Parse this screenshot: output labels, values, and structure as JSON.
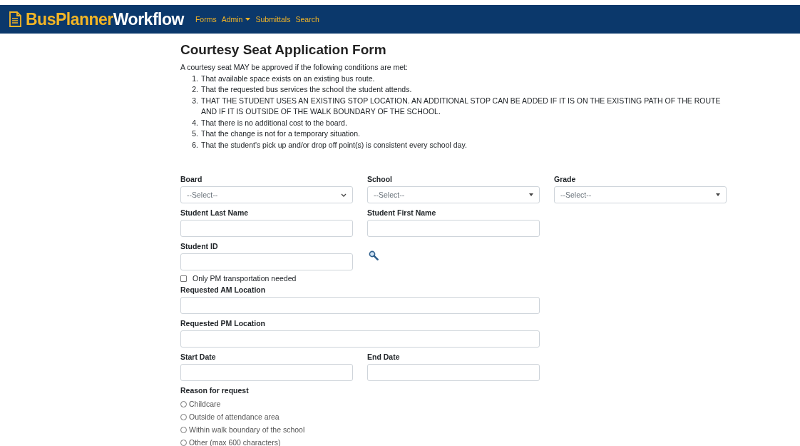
{
  "navbar": {
    "logo": {
      "part_1": "BusPlanner",
      "part_2": "Workflow"
    },
    "links": [
      {
        "label": "Forms",
        "kind": "link"
      },
      {
        "label": "Admin",
        "kind": "dropdown"
      },
      {
        "label": "Submittals",
        "kind": "link"
      },
      {
        "label": "Search",
        "kind": "link"
      }
    ]
  },
  "title": "Courtesy Seat Application Form",
  "intro": "A courtesy seat MAY be approved if the following conditions are met:",
  "conditions": [
    {
      "number": "1.",
      "text": "That available space exists on an existing bus route."
    },
    {
      "number": "2.",
      "text": "That the requested bus services the school the student attends."
    },
    {
      "number": "3.",
      "text": "THAT THE STUDENT USES AN EXISTING STOP LOCATION. AN ADDITIONAL STOP CAN BE ADDED IF IT IS ON THE EXISTING PATH OF THE ROUTE AND IF IT IS OUTSIDE OF THE WALK BOUNDARY OF THE SCHOOL."
    },
    {
      "number": "4.",
      "text": "That there is no additional cost to the board."
    },
    {
      "number": "5.",
      "text": "That the change is not for a temporary situation."
    },
    {
      "number": "6.",
      "text": "That the student's pick up and/or drop off point(s) is consistent every school day."
    }
  ],
  "rows": [
    {
      "fields": [
        {
          "label": "Board",
          "kind": "select",
          "value": "--Select--",
          "caret": {
            "kind": "chevron"
          }
        },
        {
          "label": "School",
          "kind": "select",
          "value": "--Select--",
          "caret": {
            "kind": "triangle"
          }
        },
        {
          "label": "Grade",
          "kind": "select",
          "value": "--Select--",
          "caret": {
            "kind": "triangle"
          }
        }
      ]
    },
    {
      "fields": [
        {
          "label": "Student Last Name",
          "kind": "text"
        },
        {
          "label": "Student First Name",
          "kind": "text"
        }
      ]
    },
    {
      "fields": [
        {
          "label": "Student ID",
          "kind": "text"
        },
        {
          "kind": "lookup"
        }
      ]
    }
  ],
  "pm_only": {
    "label": "Only PM transportation needed",
    "checked": false
  },
  "rows_2": [
    {
      "fields": [
        {
          "label": "Requested AM Location",
          "kind": "wide"
        }
      ]
    },
    {
      "fields": [
        {
          "label": "Requested PM Location",
          "kind": "wide"
        }
      ]
    },
    {
      "fields": [
        {
          "label": "Start Date",
          "kind": "text"
        },
        {
          "label": "End Date",
          "kind": "text"
        }
      ]
    }
  ],
  "reason": {
    "label": "Reason for request",
    "options": [
      {
        "label": "Childcare",
        "selected": false
      },
      {
        "label": "Outside of attendance area",
        "selected": false
      },
      {
        "label": "Within walk boundary of the school",
        "selected": false
      },
      {
        "label": "Other (max 600 characters)",
        "selected": false
      }
    ]
  }
}
